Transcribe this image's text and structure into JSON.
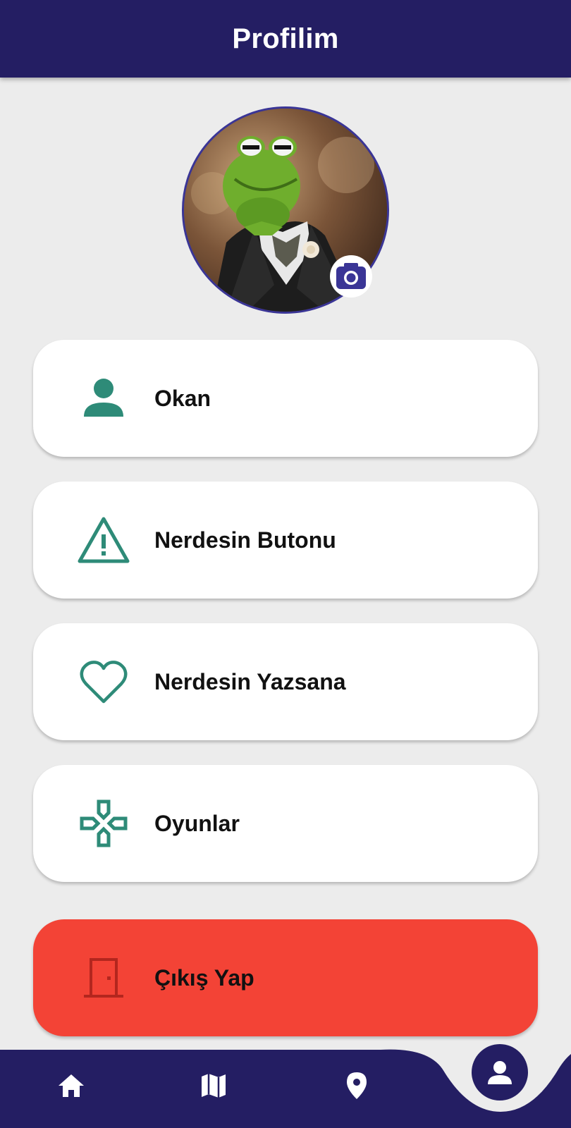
{
  "header": {
    "title": "Profilim"
  },
  "profile": {
    "avatar_alt": "Profile photo",
    "camera_icon": "camera-icon"
  },
  "menu": [
    {
      "label": "Okan",
      "icon": "person-icon"
    },
    {
      "label": "Nerdesin Butonu",
      "icon": "warning-icon"
    },
    {
      "label": "Nerdesin Yazsana",
      "icon": "heart-icon"
    },
    {
      "label": "Oyunlar",
      "icon": "gamepad-icon"
    }
  ],
  "logout": {
    "label": "Çıkış Yap",
    "icon": "door-icon"
  },
  "bottom_nav": {
    "items": [
      {
        "icon": "home-icon"
      },
      {
        "icon": "map-icon"
      },
      {
        "icon": "location-pin-icon"
      },
      {
        "icon": "person-icon",
        "active": true
      }
    ]
  },
  "colors": {
    "primary": "#241e63",
    "accent_teal": "#2e8b78",
    "logout_red": "#f34336",
    "logout_icon": "#b3261e",
    "background": "#ececec"
  }
}
